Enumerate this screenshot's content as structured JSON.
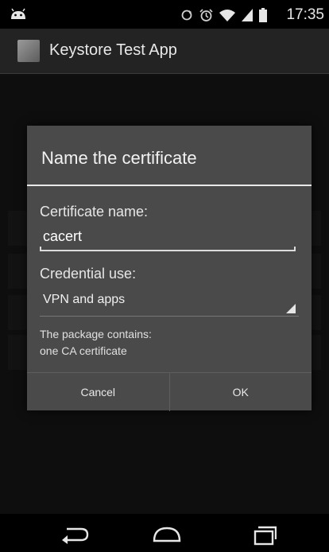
{
  "status_bar": {
    "time": "17:35",
    "icons": [
      "android-debug-icon",
      "sync-icon",
      "alarm-icon",
      "wifi-icon",
      "signal-icon",
      "battery-icon"
    ]
  },
  "action_bar": {
    "title": "Keystore Test App"
  },
  "dialog": {
    "title": "Name the certificate",
    "certificate_name_label": "Certificate name:",
    "certificate_name_value": "cacert",
    "credential_use_label": "Credential use:",
    "credential_use_value": "VPN and apps",
    "info_line1": "The package contains:",
    "info_line2": "one CA certificate",
    "cancel_label": "Cancel",
    "ok_label": "OK"
  },
  "nav_bar": {
    "buttons": [
      "back-icon",
      "home-icon",
      "recents-icon"
    ]
  },
  "colors": {
    "dialog_bg": "#4a4a4a",
    "divider": "#e8e8e8",
    "screen_bg": "#1f1f1f"
  }
}
